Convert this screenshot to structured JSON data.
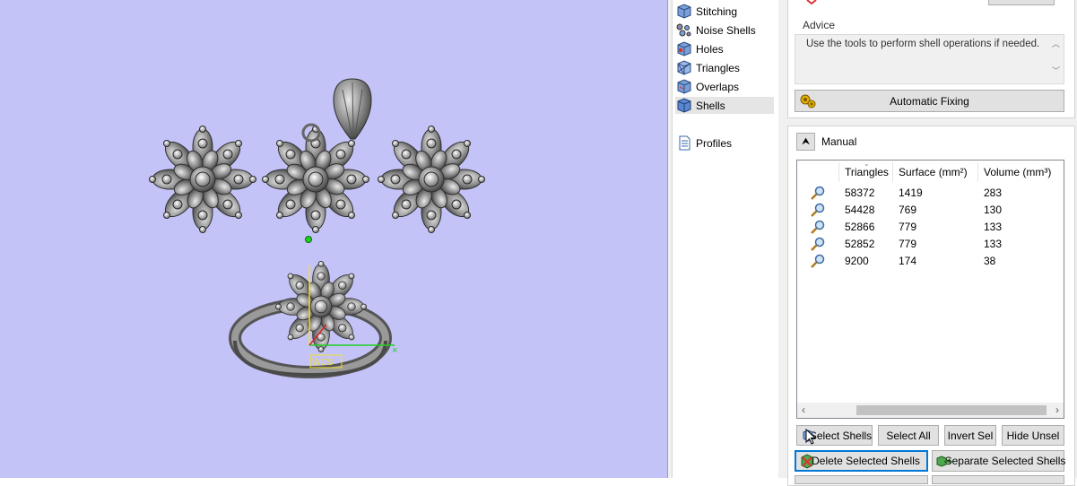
{
  "nav": {
    "items": [
      {
        "label": "Stitching",
        "icon": "stitching-icon",
        "selected": false
      },
      {
        "label": "Noise Shells",
        "icon": "noise-shells-icon",
        "selected": false
      },
      {
        "label": "Holes",
        "icon": "holes-icon",
        "selected": false
      },
      {
        "label": "Triangles",
        "icon": "triangles-icon",
        "selected": false
      },
      {
        "label": "Overlaps",
        "icon": "overlaps-icon",
        "selected": false
      },
      {
        "label": "Shells",
        "icon": "shells-icon",
        "selected": true
      }
    ],
    "profiles_label": "Profiles"
  },
  "viewport": {
    "wcs_label": "WCS",
    "background": "#c3c3f7"
  },
  "advice": {
    "title": "Advice",
    "text": "Use the tools to perform shell operations if needed.",
    "auto_fix_label": "Automatic Fixing"
  },
  "manual": {
    "title": "Manual",
    "collapse_glyph": "⮝",
    "columns": [
      "Triangles",
      "Surface (mm²)",
      "Volume (mm³)"
    ],
    "rows": [
      {
        "triangles": "58372",
        "surface": "1419",
        "volume": "283"
      },
      {
        "triangles": "54428",
        "surface": "769",
        "volume": "130"
      },
      {
        "triangles": "52866",
        "surface": "779",
        "volume": "133"
      },
      {
        "triangles": "52852",
        "surface": "779",
        "volume": "133"
      },
      {
        "triangles": "9200",
        "surface": "174",
        "volume": "38"
      }
    ],
    "buttons": {
      "select_shells": "Select Shells",
      "select_all": "Select All",
      "invert_sel": "Invert Sel",
      "hide_unsel": "Hide Unsel",
      "delete_selected": "Delete Selected Shells",
      "separate_selected": "Separate Selected Shells"
    }
  },
  "colors": {
    "accent": "#0078d7",
    "panel_bg": "#f0f0f0",
    "button_bg": "#e1e1e1"
  }
}
